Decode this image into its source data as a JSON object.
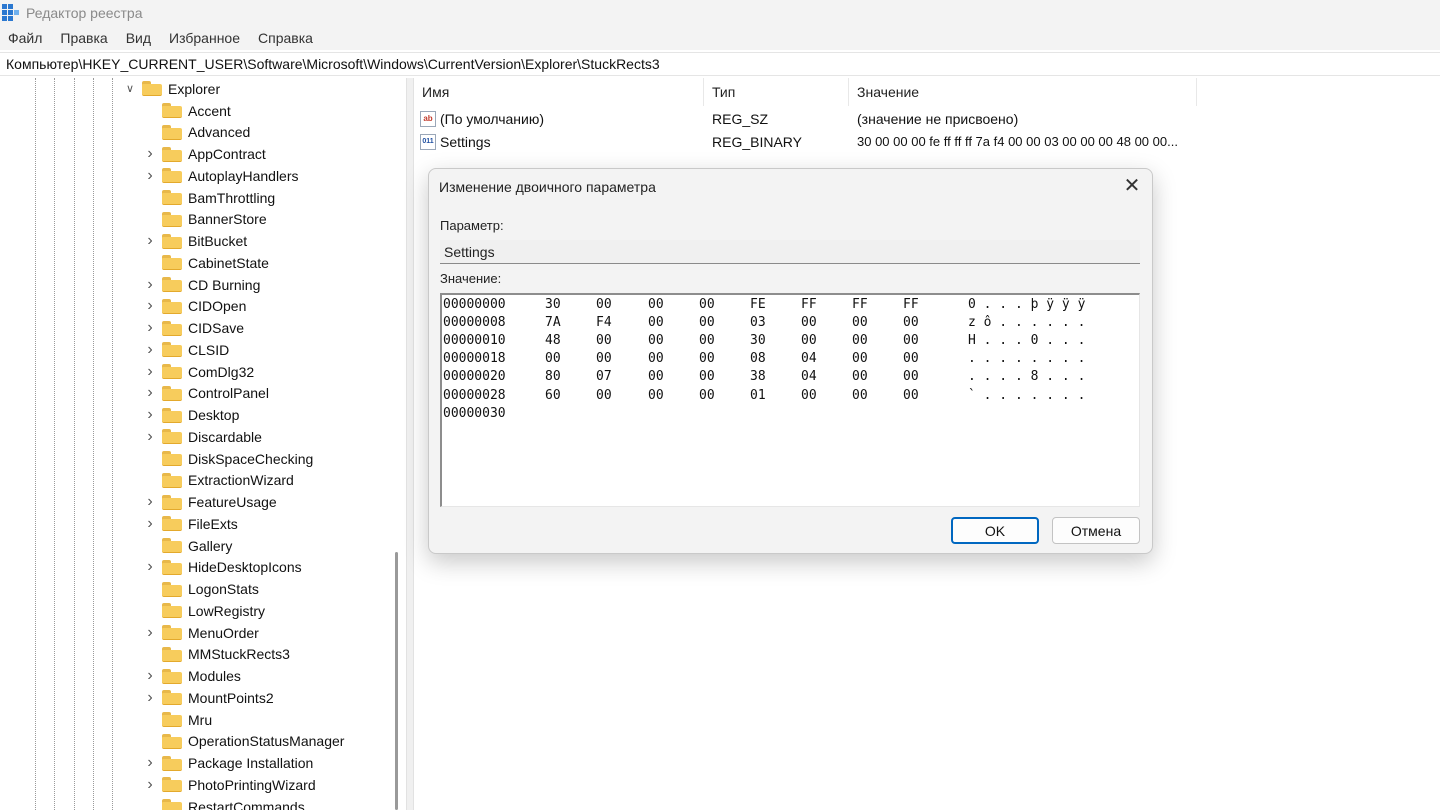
{
  "window": {
    "title": "Редактор реестра"
  },
  "menu": [
    "Файл",
    "Правка",
    "Вид",
    "Избранное",
    "Справка"
  ],
  "address": "Компьютер\\HKEY_CURRENT_USER\\Software\\Microsoft\\Windows\\CurrentVersion\\Explorer\\StuckRects3",
  "tree": {
    "parent": "Explorer",
    "items": [
      {
        "label": "Accent",
        "expandable": false
      },
      {
        "label": "Advanced",
        "expandable": false
      },
      {
        "label": "AppContract",
        "expandable": true
      },
      {
        "label": "AutoplayHandlers",
        "expandable": true
      },
      {
        "label": "BamThrottling",
        "expandable": false
      },
      {
        "label": "BannerStore",
        "expandable": false
      },
      {
        "label": "BitBucket",
        "expandable": true
      },
      {
        "label": "CabinetState",
        "expandable": false
      },
      {
        "label": "CD Burning",
        "expandable": true
      },
      {
        "label": "CIDOpen",
        "expandable": true
      },
      {
        "label": "CIDSave",
        "expandable": true
      },
      {
        "label": "CLSID",
        "expandable": true
      },
      {
        "label": "ComDlg32",
        "expandable": true
      },
      {
        "label": "ControlPanel",
        "expandable": true
      },
      {
        "label": "Desktop",
        "expandable": true
      },
      {
        "label": "Discardable",
        "expandable": true
      },
      {
        "label": "DiskSpaceChecking",
        "expandable": false
      },
      {
        "label": "ExtractionWizard",
        "expandable": false
      },
      {
        "label": "FeatureUsage",
        "expandable": true
      },
      {
        "label": "FileExts",
        "expandable": true
      },
      {
        "label": "Gallery",
        "expandable": false
      },
      {
        "label": "HideDesktopIcons",
        "expandable": true
      },
      {
        "label": "LogonStats",
        "expandable": false
      },
      {
        "label": "LowRegistry",
        "expandable": false
      },
      {
        "label": "MenuOrder",
        "expandable": true
      },
      {
        "label": "MMStuckRects3",
        "expandable": false
      },
      {
        "label": "Modules",
        "expandable": true
      },
      {
        "label": "MountPoints2",
        "expandable": true
      },
      {
        "label": "Mru",
        "expandable": false
      },
      {
        "label": "OperationStatusManager",
        "expandable": false
      },
      {
        "label": "Package Installation",
        "expandable": true
      },
      {
        "label": "PhotoPrintingWizard",
        "expandable": true
      },
      {
        "label": "RestartCommands",
        "expandable": false
      }
    ]
  },
  "list": {
    "headers": {
      "name": "Имя",
      "type": "Тип",
      "value": "Значение"
    },
    "rows": [
      {
        "icon": "string-value-icon",
        "icon_text": "ab",
        "name": "(По умолчанию)",
        "type": "REG_SZ",
        "value": "(значение не присвоено)"
      },
      {
        "icon": "binary-value-icon",
        "icon_text": "011",
        "name": "Settings",
        "type": "REG_BINARY",
        "value": "30 00 00 00 fe ff ff ff 7a f4 00 00 03 00 00 00 48 00 00..."
      }
    ]
  },
  "dialog": {
    "title": "Изменение двоичного параметра",
    "param_label": "Параметр:",
    "param_value": "Settings",
    "value_label": "Значение:",
    "hex_rows": [
      {
        "addr": "00000000",
        "bytes": [
          "30",
          "00",
          "00",
          "00",
          "FE",
          "FF",
          "FF",
          "FF"
        ],
        "ascii": "0 . . . þ ÿ ÿ ÿ"
      },
      {
        "addr": "00000008",
        "bytes": [
          "7A",
          "F4",
          "00",
          "00",
          "03",
          "00",
          "00",
          "00"
        ],
        "ascii": "z ô . . . . . ."
      },
      {
        "addr": "00000010",
        "bytes": [
          "48",
          "00",
          "00",
          "00",
          "30",
          "00",
          "00",
          "00"
        ],
        "ascii": "H . . . 0 . . ."
      },
      {
        "addr": "00000018",
        "bytes": [
          "00",
          "00",
          "00",
          "00",
          "08",
          "04",
          "00",
          "00"
        ],
        "ascii": ". . . . . . . ."
      },
      {
        "addr": "00000020",
        "bytes": [
          "80",
          "07",
          "00",
          "00",
          "38",
          "04",
          "00",
          "00"
        ],
        "ascii": ". . . . 8 . . ."
      },
      {
        "addr": "00000028",
        "bytes": [
          "60",
          "00",
          "00",
          "00",
          "01",
          "00",
          "00",
          "00"
        ],
        "ascii": "` . . . . . . ."
      },
      {
        "addr": "00000030",
        "bytes": [],
        "ascii": ""
      }
    ],
    "ok_label": "OK",
    "cancel_label": "Отмена",
    "close_glyph": "✕"
  },
  "colors": {
    "accent": "#0067c0",
    "folder": "#f7cc5c"
  }
}
